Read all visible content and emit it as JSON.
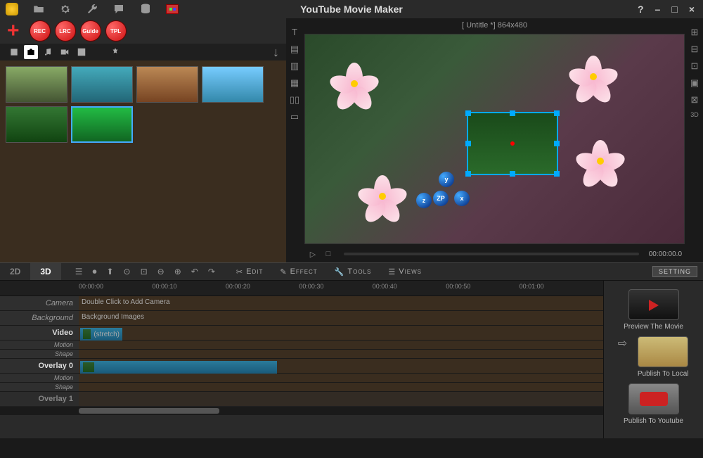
{
  "app": {
    "title": "YouTube Movie Maker"
  },
  "window_controls": {
    "help": "?",
    "minimize": "–",
    "maximize": "□",
    "close": "×"
  },
  "red_toolbar": {
    "rec": "REC",
    "lrc": "LRC",
    "guide": "Guide",
    "tpl": "TPL"
  },
  "preview": {
    "header": "[ Untitle *]  864x480",
    "timecode": "00:00:00.0",
    "badges": {
      "y": "y",
      "z": "z",
      "zp": "ZP",
      "x": "x"
    }
  },
  "mode_tabs": {
    "d2": "2D",
    "d3": "3D"
  },
  "menus": {
    "edit": "Edit",
    "effect": "Effect",
    "tools": "Tools",
    "views": "Views"
  },
  "setting_btn": "SETTING",
  "ruler": {
    "t0": "00:00:00",
    "t1": "00:00:10",
    "t2": "00:00:20",
    "t3": "00:00:30",
    "t4": "00:00:40",
    "t5": "00:00:50",
    "t6": "00:01:00"
  },
  "tracks": {
    "camera": {
      "label": "Camera",
      "hint": "Double Click to Add Camera"
    },
    "background": {
      "label": "Background",
      "hint": "Background Images"
    },
    "video": {
      "label": "Video",
      "clip": "(stretch)"
    },
    "motion": "Motion",
    "shape": "Shape",
    "overlay0": {
      "label": "Overlay 0"
    },
    "overlay1": {
      "label": "Overlay 1"
    }
  },
  "actions": {
    "preview": "Preview The Movie",
    "local": "Publish To Local",
    "youtube": "Publish To Youtube"
  }
}
